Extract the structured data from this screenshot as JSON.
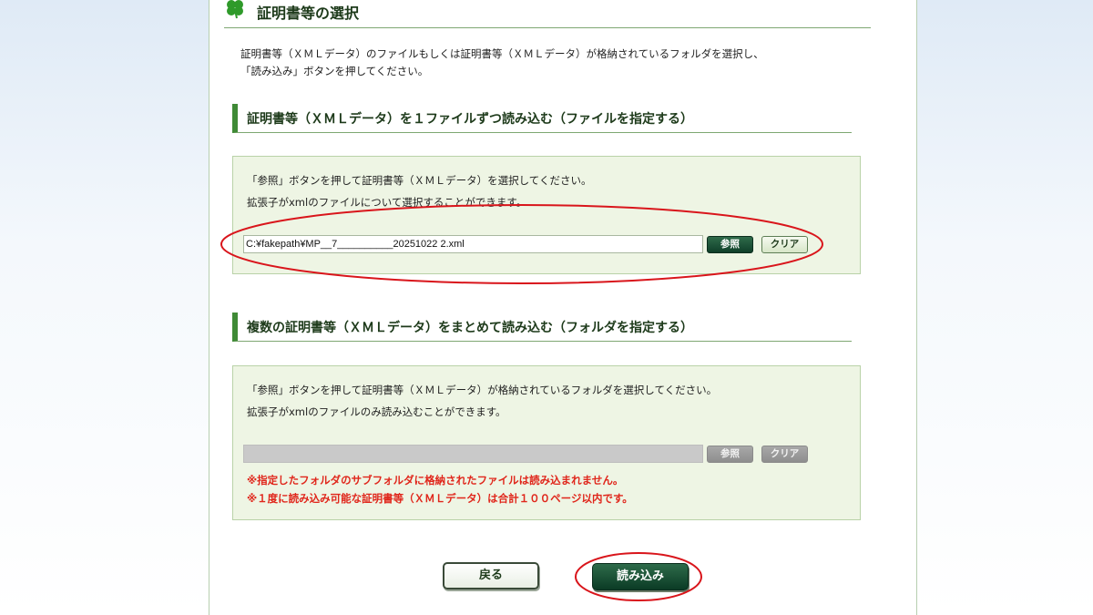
{
  "page": {
    "title": "証明書等の選択",
    "intro_line1": "証明書等（ＸＭＬデータ）のファイルもしくは証明書等（ＸＭＬデータ）が格納されているフォルダを選択し、",
    "intro_line2": "「読み込み」ボタンを押してください。"
  },
  "single_file": {
    "heading": "証明書等（ＸＭＬデータ）を１ファイルずつ読み込む（ファイルを指定する）",
    "instruction1": "「参照」ボタンを押して証明書等（ＸＭＬデータ）を選択してください。",
    "instruction2": "拡張子がxmlのファイルについて選択することができます。",
    "file_path": "C:¥fakepath¥MP__7__________20251022 2.xml",
    "browse_label": "参照",
    "clear_label": "クリア"
  },
  "folder": {
    "heading": "複数の証明書等（ＸＭＬデータ）をまとめて読み込む（フォルダを指定する）",
    "instruction1": "「参照」ボタンを押して証明書等（ＸＭＬデータ）が格納されているフォルダを選択してください。",
    "instruction2": "拡張子がxmlのファイルのみ読み込むことができます。",
    "folder_path": "",
    "browse_label": "参照",
    "clear_label": "クリア",
    "note1": "※指定したフォルダのサブフォルダに格納されたファイルは読み込まれません。",
    "note2": "※１度に読み込み可能な証明書等（ＸＭＬデータ）は合計１００ページ以内です。"
  },
  "footer": {
    "back_label": "戻る",
    "load_label": "読み込み"
  },
  "colors": {
    "accent_green": "#3f8a36",
    "dark_button": "#0f3f29",
    "panel_bg": "#eef5e4",
    "note_red": "#e0261b",
    "annotation_red": "#d9151b"
  },
  "icons": {
    "title": "clover-icon"
  }
}
